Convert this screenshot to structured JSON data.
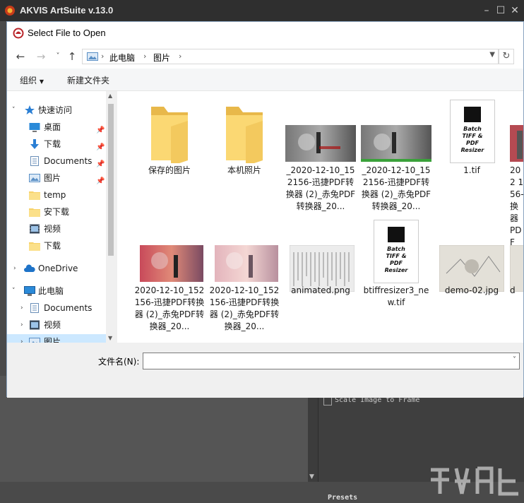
{
  "app": {
    "title": "AKVIS ArtSuite v.13.0",
    "controls": [
      "minimize-icon",
      "maximize-icon",
      "close-icon"
    ],
    "options": {
      "scale_label": "Scale Image to Frame",
      "scale_checked": false
    },
    "presets_label": "Presets"
  },
  "dialog": {
    "title": "Select File to Open",
    "address": {
      "crumbs": [
        "此电脑",
        "图片"
      ]
    },
    "toolbar": {
      "organize": "组织",
      "new_folder": "新建文件夹"
    },
    "nav": {
      "quick_access": "快速访问",
      "items": [
        {
          "label": "桌面",
          "icon": "desktop-icon",
          "pinned": true
        },
        {
          "label": "下载",
          "icon": "download-icon",
          "pinned": true
        },
        {
          "label": "Documents",
          "icon": "documents-icon",
          "pinned": true
        },
        {
          "label": "图片",
          "icon": "pictures-icon",
          "pinned": true
        },
        {
          "label": "temp",
          "icon": "folder-icon",
          "pinned": false
        },
        {
          "label": "安下载",
          "icon": "folder-icon",
          "pinned": false
        },
        {
          "label": "视频",
          "icon": "video-icon",
          "pinned": false
        },
        {
          "label": "下载",
          "icon": "folder-icon",
          "pinned": false
        }
      ],
      "onedrive": "OneDrive",
      "this_pc": "此电脑",
      "pc_items": [
        {
          "label": "Documents",
          "icon": "documents-icon"
        },
        {
          "label": "视频",
          "icon": "video-icon"
        },
        {
          "label": "图片",
          "icon": "pictures-icon"
        }
      ]
    },
    "files": [
      {
        "name": "保存的图片",
        "type": "folder"
      },
      {
        "name": "本机照片",
        "type": "folder"
      },
      {
        "name": "_2020-12-10_152156-迅捷PDF转换器 (2)_赤兔PDF转换器_20...",
        "type": "image-gray"
      },
      {
        "name": "_2020-12-10_152156-迅捷PDF转换器 (2)_赤兔PDF转换器_20...",
        "type": "image-gray"
      },
      {
        "name": "1.tif",
        "type": "image-batch"
      },
      {
        "name": "202 156- 换器 PDF",
        "type": "image-red-partial"
      },
      {
        "name": "2020-12-10_152156-迅捷PDF转换器 (2)_赤兔PDF转换器_20...",
        "type": "image-red"
      },
      {
        "name": "2020-12-10_152156-迅捷PDF转换器 (2)_赤兔PDF转换器_20...",
        "type": "image-pink"
      },
      {
        "name": "animated.png",
        "type": "image-doc"
      },
      {
        "name": "btiffresizer3_new.tif",
        "type": "image-batch"
      },
      {
        "name": "demo-02.jpg",
        "type": "image-sketch"
      },
      {
        "name": "d",
        "type": "image-sketch-partial"
      }
    ],
    "thumb_text": {
      "line1": "Batch",
      "line2": "TIFF &",
      "line3": "PDF",
      "line4": "Resizer"
    },
    "filename_label": "文件名(N):",
    "filename_value": ""
  }
}
